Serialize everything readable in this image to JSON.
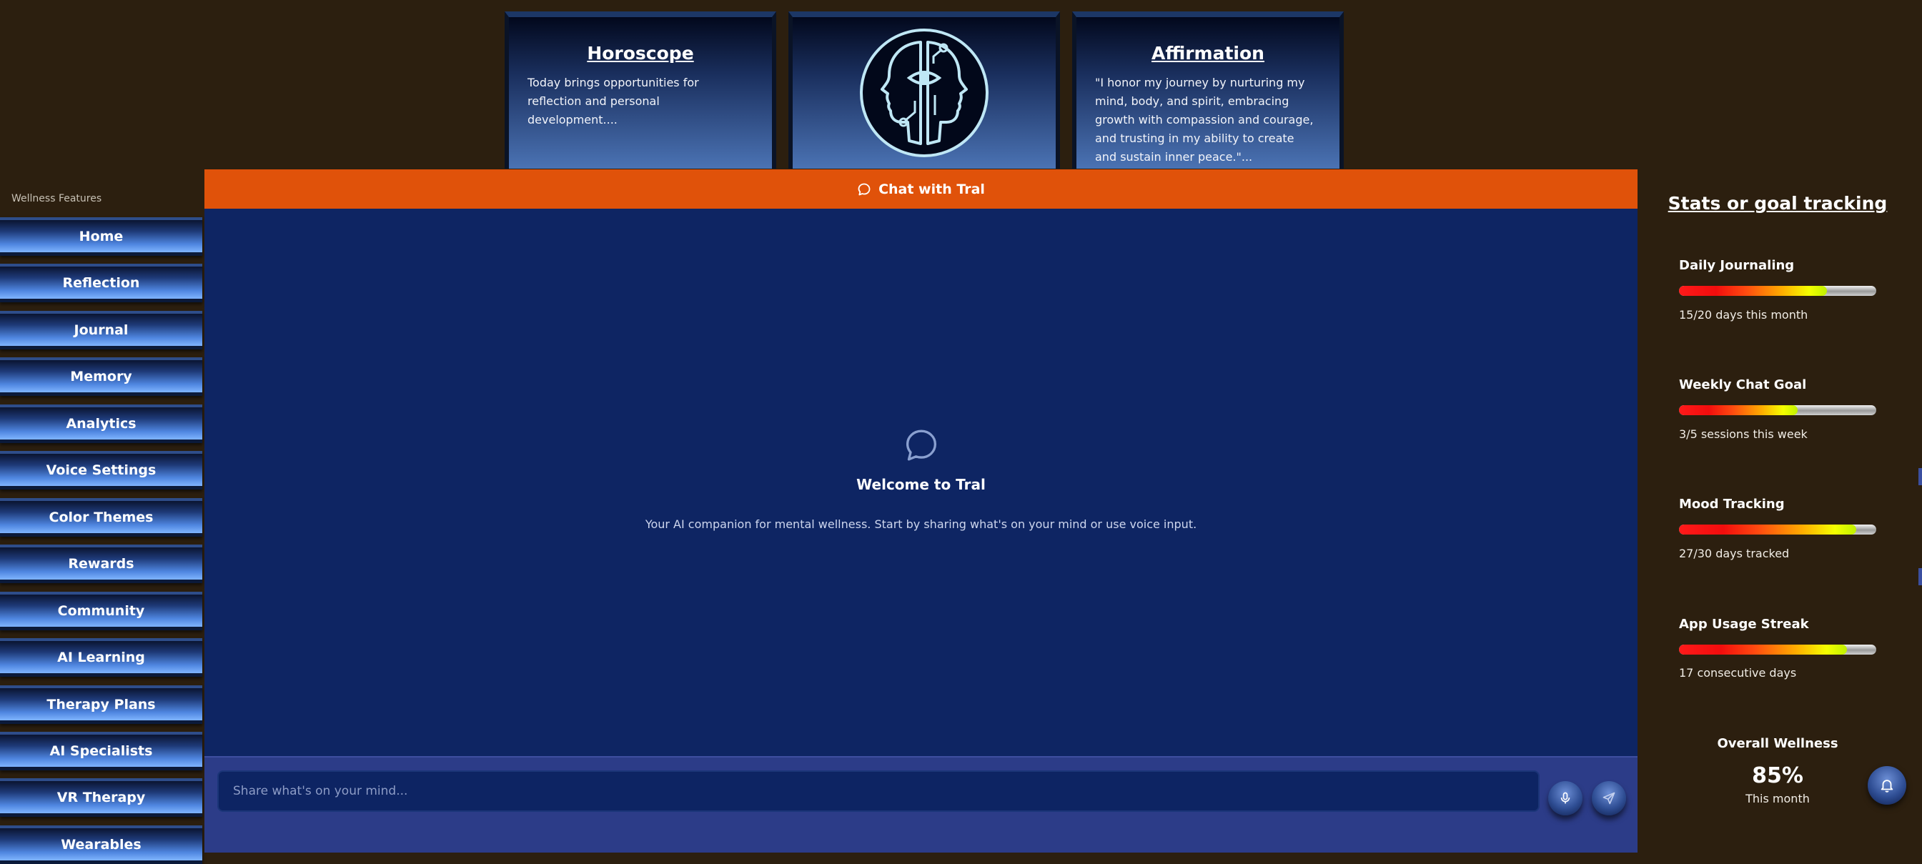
{
  "cards": {
    "horoscope": {
      "title": "Horoscope",
      "text": "Today brings opportunities for reflection and personal development...."
    },
    "logo": {
      "icon": "mind-eye-logo"
    },
    "affirmation": {
      "title": "Affirmation",
      "text": "\"I honor my journey by nurturing my mind, body, and spirit, embracing growth with compassion and courage, and trusting in my ability to create and sustain inner peace.\"..."
    }
  },
  "sidebar": {
    "header": "Wellness Features",
    "items": [
      {
        "label": "Home"
      },
      {
        "label": "Reflection"
      },
      {
        "label": "Journal"
      },
      {
        "label": "Memory"
      },
      {
        "label": "Analytics"
      },
      {
        "label": "Voice Settings"
      },
      {
        "label": "Color Themes"
      },
      {
        "label": "Rewards"
      },
      {
        "label": "Community"
      },
      {
        "label": "AI Learning"
      },
      {
        "label": "Therapy Plans"
      },
      {
        "label": "AI Specialists"
      },
      {
        "label": "VR Therapy"
      },
      {
        "label": "Wearables"
      }
    ]
  },
  "chat": {
    "header_label": "Chat with Tral",
    "welcome_title": "Welcome to Tral",
    "welcome_text": "Your AI companion for mental wellness. Start by sharing what's on your mind or use voice input.",
    "input_placeholder": "Share what's on your mind...",
    "input_value": ""
  },
  "stats": {
    "title": "Stats or goal tracking",
    "items": [
      {
        "label": "Daily Journaling",
        "progress": 0.75,
        "sub": "15/20 days this month"
      },
      {
        "label": "Weekly Chat Goal",
        "progress": 0.6,
        "sub": "3/5 sessions this week"
      },
      {
        "label": "Mood Tracking",
        "progress": 0.9,
        "sub": "27/30 days tracked"
      },
      {
        "label": "App Usage Streak",
        "progress": 0.85,
        "sub": "17 consecutive days"
      }
    ],
    "overall": {
      "title": "Overall Wellness",
      "value": "85%",
      "sub": "This month"
    }
  },
  "colors": {
    "background": "#2c1f0f",
    "chat_header": "#e0520a",
    "chat_body": "#0e2563",
    "chat_footer": "#2c3c88"
  }
}
